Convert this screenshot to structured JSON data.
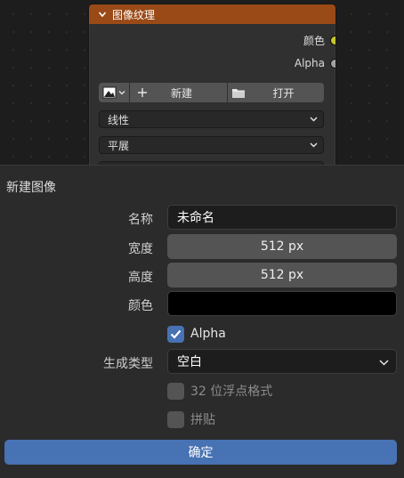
{
  "node": {
    "title": "图像纹理",
    "outputs": [
      {
        "label": "颜色",
        "socket_color": "#c7c729"
      },
      {
        "label": "Alpha",
        "socket_color": "#a1a1a1"
      }
    ],
    "toolbar": {
      "image_icon": "image-icon",
      "new_label": "新建",
      "open_label": "打开"
    },
    "interpolation": "线性",
    "projection": "平展"
  },
  "dialog": {
    "title": "新建图像",
    "name_label": "名称",
    "name_value": "未命名",
    "width_label": "宽度",
    "width_value": "512 px",
    "height_label": "高度",
    "height_value": "512 px",
    "color_label": "颜色",
    "color_value": "#000000",
    "alpha_label": "Alpha",
    "alpha_checked": true,
    "generated_type_label": "生成类型",
    "generated_type_value": "空白",
    "float_label": "32 位浮点格式",
    "float_checked": false,
    "tiled_label": "拼贴",
    "tiled_checked": false,
    "ok_label": "确定"
  },
  "colors": {
    "node_header": "#9a4a17",
    "accent": "#4772b3",
    "background": "#1d1d1d",
    "dialog_bg": "#2b2b2b"
  }
}
